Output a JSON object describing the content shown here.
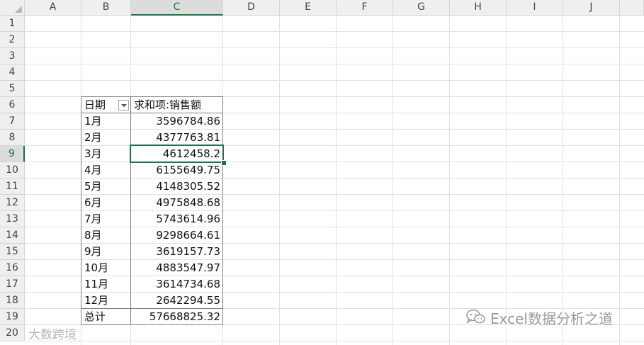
{
  "columns": [
    "A",
    "B",
    "C",
    "D",
    "E",
    "F",
    "G",
    "H",
    "I",
    "J"
  ],
  "rows": [
    "1",
    "2",
    "3",
    "4",
    "5",
    "6",
    "7",
    "8",
    "9",
    "10",
    "11",
    "12",
    "13",
    "14",
    "15",
    "16",
    "17",
    "18",
    "19",
    "20"
  ],
  "selected": {
    "column": "C",
    "row": "9"
  },
  "pivot": {
    "header_label": "日期",
    "value_header": "求和项:销售额",
    "filter_icon": "dropdown-filter-icon",
    "rows": [
      {
        "label": "1月",
        "value": "3596784.86"
      },
      {
        "label": "2月",
        "value": "4377763.81"
      },
      {
        "label": "3月",
        "value": "4612458.2"
      },
      {
        "label": "4月",
        "value": "6155649.75"
      },
      {
        "label": "5月",
        "value": "4148305.52"
      },
      {
        "label": "6月",
        "value": "4975848.68"
      },
      {
        "label": "7月",
        "value": "5743614.96"
      },
      {
        "label": "8月",
        "value": "9298664.61"
      },
      {
        "label": "9月",
        "value": "3619157.73"
      },
      {
        "label": "10月",
        "value": "4883547.97"
      },
      {
        "label": "11月",
        "value": "3614734.68"
      },
      {
        "label": "12月",
        "value": "2642294.55"
      }
    ],
    "total_label": "总计",
    "total_value": "57668825.32"
  },
  "watermark": {
    "right_text": "Excel数据分析之道",
    "left_text": "大数跨境",
    "icon": "wechat-icon"
  },
  "colors": {
    "accent": "#217346",
    "grid": "#e1e1e1",
    "header_bg": "#efefef"
  }
}
